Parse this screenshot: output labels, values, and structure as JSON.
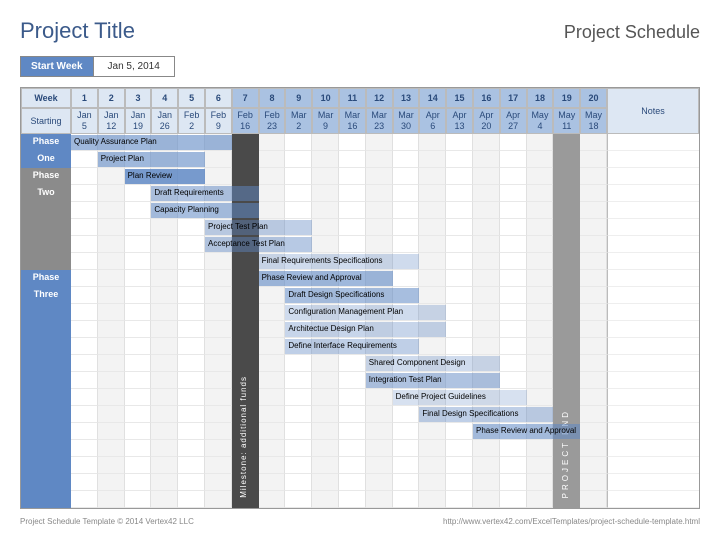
{
  "header": {
    "title": "Project Title",
    "subtitle": "Project Schedule"
  },
  "startweek": {
    "label": "Start Week",
    "value": "Jan 5, 2014"
  },
  "columns": {
    "week_label": "Week",
    "starting_label": "Starting",
    "notes_label": "Notes",
    "weeks": [
      "1",
      "2",
      "3",
      "4",
      "5",
      "6",
      "7",
      "8",
      "9",
      "10",
      "11",
      "12",
      "13",
      "14",
      "15",
      "16",
      "17",
      "18",
      "19",
      "20"
    ],
    "dates": [
      [
        "Jan",
        "5"
      ],
      [
        "Jan",
        "12"
      ],
      [
        "Jan",
        "19"
      ],
      [
        "Jan",
        "26"
      ],
      [
        "Feb",
        "2"
      ],
      [
        "Feb",
        "9"
      ],
      [
        "Feb",
        "16"
      ],
      [
        "Feb",
        "23"
      ],
      [
        "Mar",
        "2"
      ],
      [
        "Mar",
        "9"
      ],
      [
        "Mar",
        "16"
      ],
      [
        "Mar",
        "23"
      ],
      [
        "Mar",
        "30"
      ],
      [
        "Apr",
        "6"
      ],
      [
        "Apr",
        "13"
      ],
      [
        "Apr",
        "20"
      ],
      [
        "Apr",
        "27"
      ],
      [
        "May",
        "4"
      ],
      [
        "May",
        "11"
      ],
      [
        "May",
        "18"
      ]
    ]
  },
  "phases": [
    "Phase",
    "One",
    "Phase",
    "Two",
    "",
    "",
    "",
    "",
    "Phase",
    "Three"
  ],
  "phase_colors": [
    "ph-blue",
    "ph-blue",
    "ph-gray",
    "ph-gray",
    "ph-gray",
    "ph-gray",
    "ph-gray",
    "ph-gray",
    "ph-blue",
    "ph-blue",
    "ph-blue",
    "ph-blue",
    "ph-blue",
    "ph-blue",
    "ph-blue",
    "ph-blue",
    "ph-blue",
    "ph-blue",
    "ph-blue",
    "ph-blue",
    "ph-blue",
    "ph-blue"
  ],
  "milestone": {
    "label": "Milestone: additional funds"
  },
  "project_end": {
    "label": "PROJECT END"
  },
  "chart_data": {
    "type": "bar",
    "title": "Project Schedule",
    "xlabel": "Week",
    "x": [
      1,
      2,
      3,
      4,
      5,
      6,
      7,
      8,
      9,
      10,
      11,
      12,
      13,
      14,
      15,
      16,
      17,
      18,
      19,
      20
    ],
    "tasks": [
      {
        "name": "Quality Assurance Plan",
        "row": 0,
        "start": 1,
        "end": 6,
        "shade": 60
      },
      {
        "name": "Project Plan",
        "row": 1,
        "start": 2,
        "end": 5,
        "shade": 60
      },
      {
        "name": "Plan Review",
        "row": 2,
        "start": 3,
        "end": 5,
        "shade": 85
      },
      {
        "name": "Draft Requirements",
        "row": 3,
        "start": 4,
        "end": 7,
        "shade": 50
      },
      {
        "name": "Capacity Planning",
        "row": 4,
        "start": 4,
        "end": 7,
        "shade": 55
      },
      {
        "name": "Project Test Plan",
        "row": 5,
        "start": 6,
        "end": 9,
        "shade": 40
      },
      {
        "name": "Acceptance Test Plan",
        "row": 6,
        "start": 6,
        "end": 9,
        "shade": 45
      },
      {
        "name": "Final Requirements Specifications",
        "row": 7,
        "start": 8,
        "end": 13,
        "shade": 30
      },
      {
        "name": "Phase Review and Approval",
        "row": 8,
        "start": 8,
        "end": 12,
        "shade": 60
      },
      {
        "name": "Draft Design Specifications",
        "row": 9,
        "start": 9,
        "end": 13,
        "shade": 55
      },
      {
        "name": "Configuration Management Plan",
        "row": 10,
        "start": 9,
        "end": 14,
        "shade": 30
      },
      {
        "name": "Architectue Design Plan",
        "row": 11,
        "start": 9,
        "end": 14,
        "shade": 35
      },
      {
        "name": "Define Interface Requirements",
        "row": 12,
        "start": 9,
        "end": 13,
        "shade": 40
      },
      {
        "name": "Shared Component Design",
        "row": 13,
        "start": 12,
        "end": 16,
        "shade": 30
      },
      {
        "name": "Integration Test Plan",
        "row": 14,
        "start": 12,
        "end": 16,
        "shade": 50
      },
      {
        "name": "Define Project Guidelines",
        "row": 15,
        "start": 13,
        "end": 17,
        "shade": 25
      },
      {
        "name": "Final Design Specifications",
        "row": 16,
        "start": 14,
        "end": 18,
        "shade": 40
      },
      {
        "name": "Phase Review and Approval",
        "row": 17,
        "start": 16,
        "end": 19,
        "shade": 55
      }
    ],
    "milestone_col": 7,
    "project_end_col": 19
  },
  "footer": {
    "left": "Project Schedule Template © 2014 Vertex42 LLC",
    "right": "http://www.vertex42.com/ExcelTemplates/project-schedule-template.html"
  }
}
